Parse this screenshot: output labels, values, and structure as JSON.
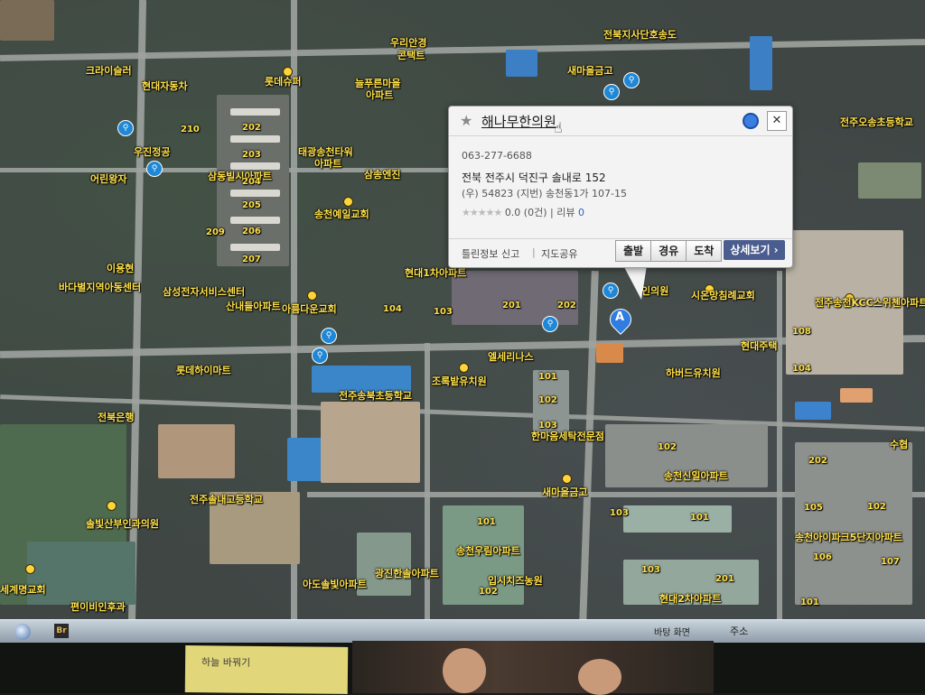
{
  "popup": {
    "title": "해나무한의원",
    "phone": "063-277-6688",
    "address": "전북 전주시 덕진구 솔내로 152",
    "address_detail": "(우) 54823 (지번) 송천동1가 107-15",
    "rating": {
      "stars": "★★★★★",
      "score_text": "0.0 (0건)",
      "separator": "|",
      "review_label": "리뷰",
      "review_count": "0"
    },
    "footer": {
      "report_label": "틀린정보 신고",
      "share_label": "지도공유"
    },
    "buttons": {
      "depart": "출발",
      "via": "경유",
      "arrive": "도착",
      "details": "상세보기 ›"
    },
    "close_glyph": "✕",
    "star_glyph": "★"
  },
  "marker": {
    "letter": "A"
  },
  "map_labels": [
    {
      "text": "크라이슬러"
    },
    {
      "text": "현대자동차"
    },
    {
      "text": "우리안경"
    },
    {
      "text": "콘택트"
    },
    {
      "text": "롯데슈퍼"
    },
    {
      "text": "늘푸른마을"
    },
    {
      "text": "아파트"
    },
    {
      "text": "새마을금고"
    },
    {
      "text": "전북지사단호송도"
    },
    {
      "text": "태광송천타워"
    },
    {
      "text": "아파트"
    },
    {
      "text": "삼송엔진"
    },
    {
      "text": "송천예일교회"
    },
    {
      "text": "우진정공"
    },
    {
      "text": "어린왕자"
    },
    {
      "text": "삼동빌시아파트"
    },
    {
      "text": "바다별지역아동센터"
    },
    {
      "text": "이용현"
    },
    {
      "text": "삼성전자서비스센터"
    },
    {
      "text": "산내들아파트"
    },
    {
      "text": "아름다운교회"
    },
    {
      "text": "현대1차아파트"
    },
    {
      "text": "롯데하이마트"
    },
    {
      "text": "전주송북초등학교"
    },
    {
      "text": "전북은행"
    },
    {
      "text": "조록밭유치원"
    },
    {
      "text": "엘세리나스"
    },
    {
      "text": "한마음세탁전문점"
    },
    {
      "text": "새마을금고"
    },
    {
      "text": "송천신일아파트"
    },
    {
      "text": "전주솔내고등학교"
    },
    {
      "text": "솔빛산부인과의원"
    },
    {
      "text": "송천우림아파트"
    },
    {
      "text": "광진한솔아파트"
    },
    {
      "text": "아도솔빛아파트"
    },
    {
      "text": "입시치즈농원"
    },
    {
      "text": "현대2차아파트"
    },
    {
      "text": "세계명교회"
    },
    {
      "text": "편이비인후과"
    },
    {
      "text": "현대주택"
    },
    {
      "text": "하버드유치원"
    },
    {
      "text": "전주송천KCC스위첸아파트"
    },
    {
      "text": "송천아이파크5단지아파트"
    },
    {
      "text": "전주오송초등학교"
    },
    {
      "text": "시온망침례교회"
    },
    {
      "text": "인의원"
    },
    {
      "text": "수협"
    }
  ],
  "building_numbers": [
    "210",
    "202",
    "203",
    "204",
    "205",
    "206",
    "207",
    "209",
    "101",
    "102",
    "103",
    "104",
    "201",
    "202",
    "103",
    "101",
    "102",
    "103",
    "101",
    "102",
    "103",
    "201",
    "202",
    "105",
    "106",
    "107",
    "102",
    "101",
    "108",
    "104",
    "105"
  ],
  "taskbar": {
    "app_label": "Br",
    "desktop_label": "바탕 화면",
    "address_label": "주소"
  },
  "desk": {
    "sticky_note": "하늘 바꿔기"
  }
}
